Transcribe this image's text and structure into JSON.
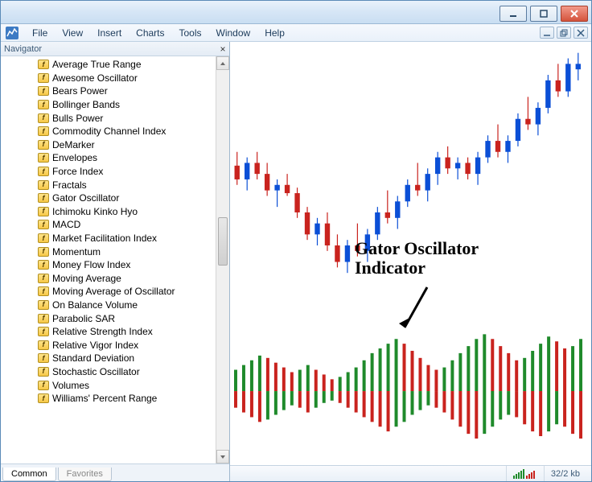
{
  "menu": [
    "File",
    "View",
    "Insert",
    "Charts",
    "Tools",
    "Window",
    "Help"
  ],
  "navigator": {
    "title": "Navigator",
    "items": [
      "Average True Range",
      "Awesome Oscillator",
      "Bears Power",
      "Bollinger Bands",
      "Bulls Power",
      "Commodity Channel Index",
      "DeMarker",
      "Envelopes",
      "Force Index",
      "Fractals",
      "Gator Oscillator",
      "Ichimoku Kinko Hyo",
      "MACD",
      "Market Facilitation Index",
      "Momentum",
      "Money Flow Index",
      "Moving Average",
      "Moving Average of Oscillator",
      "On Balance Volume",
      "Parabolic SAR",
      "Relative Strength Index",
      "Relative Vigor Index",
      "Standard Deviation",
      "Stochastic Oscillator",
      "Volumes",
      "Williams' Percent Range"
    ],
    "tabs": {
      "common": "Common",
      "favorites": "Favorites"
    }
  },
  "annotation": {
    "line1": "Gator Oscillator",
    "line2": "Indicator"
  },
  "status": {
    "conn": "32/2 kb"
  },
  "colors": {
    "bull": "#1f8a2b",
    "bear": "#c9231e",
    "wick_up": "#0b4fd6",
    "wick_dn": "#c9231e"
  },
  "chart_data": {
    "type": "candlestick-with-indicator",
    "price_panel": {
      "ylim": [
        0,
        100
      ],
      "candles": [
        {
          "o": 55,
          "h": 60,
          "l": 48,
          "c": 50,
          "color": "dn"
        },
        {
          "o": 50,
          "h": 58,
          "l": 46,
          "c": 56,
          "color": "up"
        },
        {
          "o": 56,
          "h": 60,
          "l": 50,
          "c": 52,
          "color": "dn"
        },
        {
          "o": 52,
          "h": 56,
          "l": 44,
          "c": 46,
          "color": "dn"
        },
        {
          "o": 46,
          "h": 50,
          "l": 40,
          "c": 48,
          "color": "up"
        },
        {
          "o": 48,
          "h": 52,
          "l": 44,
          "c": 45,
          "color": "dn"
        },
        {
          "o": 45,
          "h": 47,
          "l": 36,
          "c": 38,
          "color": "dn"
        },
        {
          "o": 38,
          "h": 40,
          "l": 28,
          "c": 30,
          "color": "dn"
        },
        {
          "o": 30,
          "h": 36,
          "l": 26,
          "c": 34,
          "color": "up"
        },
        {
          "o": 34,
          "h": 38,
          "l": 24,
          "c": 26,
          "color": "dn"
        },
        {
          "o": 26,
          "h": 30,
          "l": 18,
          "c": 20,
          "color": "dn"
        },
        {
          "o": 20,
          "h": 28,
          "l": 16,
          "c": 26,
          "color": "up"
        },
        {
          "o": 26,
          "h": 34,
          "l": 22,
          "c": 24,
          "color": "dn"
        },
        {
          "o": 24,
          "h": 32,
          "l": 20,
          "c": 30,
          "color": "up"
        },
        {
          "o": 30,
          "h": 40,
          "l": 28,
          "c": 38,
          "color": "up"
        },
        {
          "o": 38,
          "h": 46,
          "l": 34,
          "c": 36,
          "color": "dn"
        },
        {
          "o": 36,
          "h": 44,
          "l": 32,
          "c": 42,
          "color": "up"
        },
        {
          "o": 42,
          "h": 50,
          "l": 40,
          "c": 48,
          "color": "up"
        },
        {
          "o": 48,
          "h": 56,
          "l": 44,
          "c": 46,
          "color": "dn"
        },
        {
          "o": 46,
          "h": 54,
          "l": 42,
          "c": 52,
          "color": "up"
        },
        {
          "o": 52,
          "h": 60,
          "l": 48,
          "c": 58,
          "color": "up"
        },
        {
          "o": 58,
          "h": 62,
          "l": 52,
          "c": 54,
          "color": "dn"
        },
        {
          "o": 54,
          "h": 58,
          "l": 50,
          "c": 56,
          "color": "up"
        },
        {
          "o": 56,
          "h": 58,
          "l": 50,
          "c": 52,
          "color": "dn"
        },
        {
          "o": 52,
          "h": 60,
          "l": 48,
          "c": 58,
          "color": "up"
        },
        {
          "o": 58,
          "h": 66,
          "l": 56,
          "c": 64,
          "color": "up"
        },
        {
          "o": 64,
          "h": 70,
          "l": 58,
          "c": 60,
          "color": "dn"
        },
        {
          "o": 60,
          "h": 66,
          "l": 56,
          "c": 64,
          "color": "up"
        },
        {
          "o": 64,
          "h": 74,
          "l": 62,
          "c": 72,
          "color": "up"
        },
        {
          "o": 72,
          "h": 80,
          "l": 68,
          "c": 70,
          "color": "dn"
        },
        {
          "o": 70,
          "h": 78,
          "l": 66,
          "c": 76,
          "color": "up"
        },
        {
          "o": 76,
          "h": 88,
          "l": 74,
          "c": 86,
          "color": "up"
        },
        {
          "o": 86,
          "h": 92,
          "l": 80,
          "c": 82,
          "color": "dn"
        },
        {
          "o": 82,
          "h": 94,
          "l": 80,
          "c": 92,
          "color": "up"
        },
        {
          "o": 92,
          "h": 96,
          "l": 86,
          "c": 90,
          "color": "up"
        }
      ]
    },
    "gator_panel": {
      "upper": [
        {
          "v": 18,
          "c": "g"
        },
        {
          "v": 22,
          "c": "g"
        },
        {
          "v": 26,
          "c": "g"
        },
        {
          "v": 30,
          "c": "g"
        },
        {
          "v": 28,
          "c": "r"
        },
        {
          "v": 24,
          "c": "r"
        },
        {
          "v": 20,
          "c": "r"
        },
        {
          "v": 16,
          "c": "r"
        },
        {
          "v": 18,
          "c": "g"
        },
        {
          "v": 22,
          "c": "g"
        },
        {
          "v": 18,
          "c": "r"
        },
        {
          "v": 14,
          "c": "r"
        },
        {
          "v": 10,
          "c": "r"
        },
        {
          "v": 12,
          "c": "g"
        },
        {
          "v": 16,
          "c": "g"
        },
        {
          "v": 20,
          "c": "g"
        },
        {
          "v": 26,
          "c": "g"
        },
        {
          "v": 32,
          "c": "g"
        },
        {
          "v": 36,
          "c": "g"
        },
        {
          "v": 40,
          "c": "g"
        },
        {
          "v": 44,
          "c": "g"
        },
        {
          "v": 40,
          "c": "r"
        },
        {
          "v": 34,
          "c": "r"
        },
        {
          "v": 28,
          "c": "r"
        },
        {
          "v": 22,
          "c": "r"
        },
        {
          "v": 18,
          "c": "r"
        },
        {
          "v": 20,
          "c": "g"
        },
        {
          "v": 26,
          "c": "g"
        },
        {
          "v": 32,
          "c": "g"
        },
        {
          "v": 38,
          "c": "g"
        },
        {
          "v": 44,
          "c": "g"
        },
        {
          "v": 48,
          "c": "g"
        },
        {
          "v": 44,
          "c": "r"
        },
        {
          "v": 38,
          "c": "r"
        },
        {
          "v": 32,
          "c": "r"
        },
        {
          "v": 26,
          "c": "r"
        },
        {
          "v": 28,
          "c": "g"
        },
        {
          "v": 34,
          "c": "g"
        },
        {
          "v": 40,
          "c": "g"
        },
        {
          "v": 46,
          "c": "g"
        },
        {
          "v": 42,
          "c": "r"
        },
        {
          "v": 36,
          "c": "r"
        },
        {
          "v": 38,
          "c": "g"
        },
        {
          "v": 44,
          "c": "g"
        }
      ],
      "lower": [
        {
          "v": 14,
          "c": "r"
        },
        {
          "v": 18,
          "c": "r"
        },
        {
          "v": 22,
          "c": "r"
        },
        {
          "v": 26,
          "c": "r"
        },
        {
          "v": 24,
          "c": "g"
        },
        {
          "v": 20,
          "c": "g"
        },
        {
          "v": 16,
          "c": "g"
        },
        {
          "v": 12,
          "c": "g"
        },
        {
          "v": 14,
          "c": "r"
        },
        {
          "v": 18,
          "c": "r"
        },
        {
          "v": 14,
          "c": "g"
        },
        {
          "v": 10,
          "c": "g"
        },
        {
          "v": 8,
          "c": "g"
        },
        {
          "v": 10,
          "c": "r"
        },
        {
          "v": 14,
          "c": "r"
        },
        {
          "v": 18,
          "c": "r"
        },
        {
          "v": 22,
          "c": "r"
        },
        {
          "v": 26,
          "c": "r"
        },
        {
          "v": 30,
          "c": "r"
        },
        {
          "v": 34,
          "c": "r"
        },
        {
          "v": 30,
          "c": "g"
        },
        {
          "v": 26,
          "c": "g"
        },
        {
          "v": 20,
          "c": "g"
        },
        {
          "v": 16,
          "c": "g"
        },
        {
          "v": 12,
          "c": "g"
        },
        {
          "v": 14,
          "c": "r"
        },
        {
          "v": 18,
          "c": "r"
        },
        {
          "v": 24,
          "c": "r"
        },
        {
          "v": 30,
          "c": "r"
        },
        {
          "v": 36,
          "c": "r"
        },
        {
          "v": 40,
          "c": "r"
        },
        {
          "v": 36,
          "c": "g"
        },
        {
          "v": 30,
          "c": "g"
        },
        {
          "v": 24,
          "c": "g"
        },
        {
          "v": 20,
          "c": "g"
        },
        {
          "v": 22,
          "c": "r"
        },
        {
          "v": 28,
          "c": "r"
        },
        {
          "v": 34,
          "c": "r"
        },
        {
          "v": 38,
          "c": "r"
        },
        {
          "v": 34,
          "c": "g"
        },
        {
          "v": 28,
          "c": "g"
        },
        {
          "v": 30,
          "c": "r"
        },
        {
          "v": 36,
          "c": "r"
        },
        {
          "v": 40,
          "c": "r"
        }
      ]
    }
  }
}
